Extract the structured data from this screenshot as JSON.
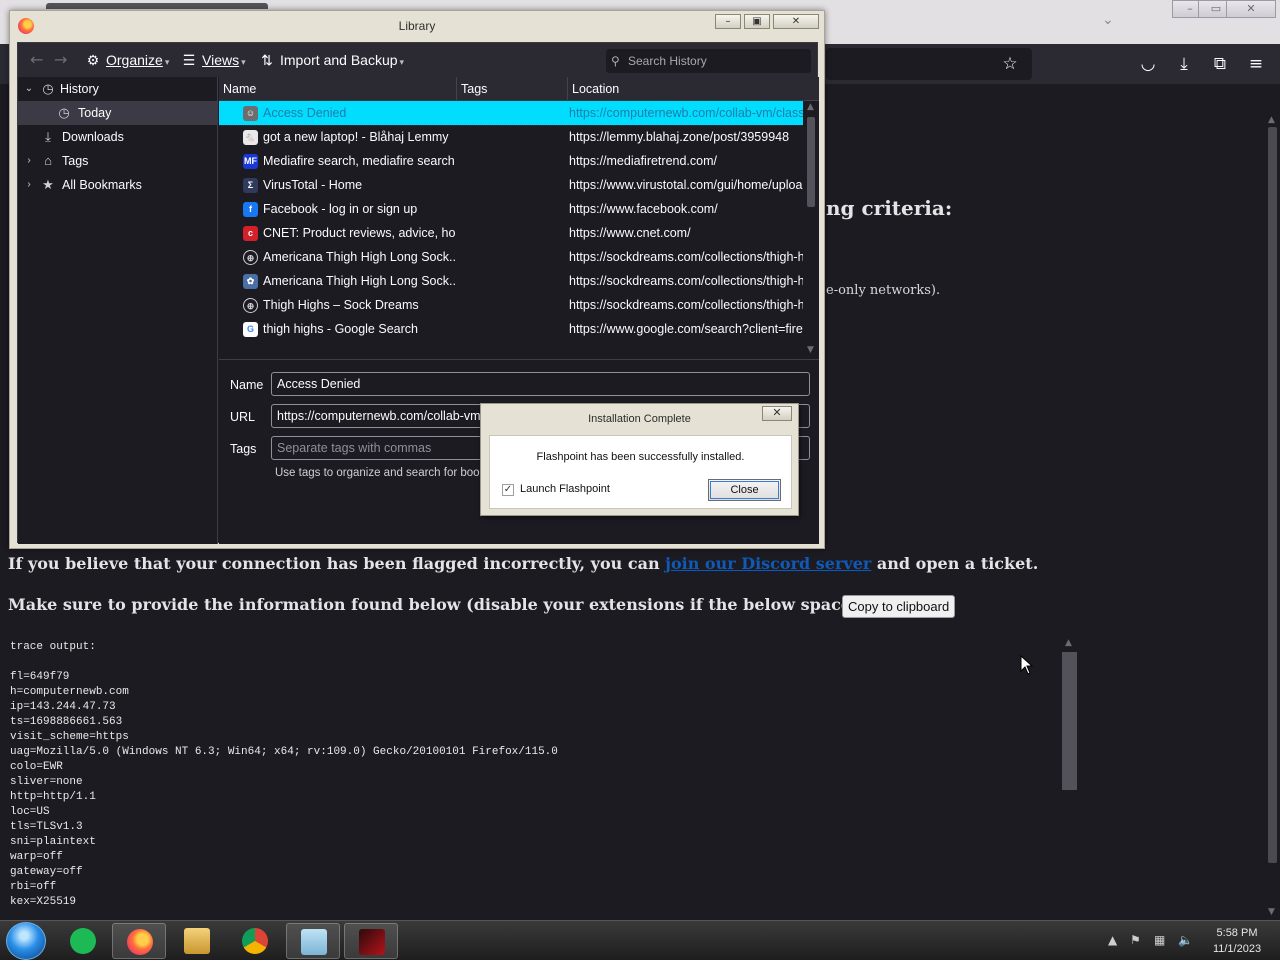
{
  "browser": {
    "page_fragments": {
      "criteria": "ng criteria:",
      "networks": "e-only networks)."
    },
    "flag_line": {
      "before": "If you believe that your connection has been flagged incorrectly, you can",
      "link": "join our Discord server",
      "after": "and open a ticket."
    },
    "provide_line": "Make sure to provide the information found below (disable your extensions if the below space is empty):",
    "copy_button": "Copy to clipboard",
    "trace_output": "trace output:\n\nfl=649f79\nh=computernewb.com\nip=143.244.47.73\nts=1698886661.563\nvisit_scheme=https\nuag=Mozilla/5.0 (Windows NT 6.3; Win64; x64; rv:109.0) Gecko/20100101 Firefox/115.0\ncolo=EWR\nsliver=none\nhttp=http/1.1\nloc=US\ntls=TLSv1.3\nsni=plaintext\nwarp=off\ngateway=off\nrbi=off\nkex=X25519"
  },
  "library": {
    "title": "Library",
    "toolbar": {
      "organize": "Organize",
      "views": "Views",
      "import_backup": "Import and Backup",
      "search_placeholder": "Search History"
    },
    "sidebar": [
      {
        "label": "History",
        "icon": "clock-icon",
        "expanded": true
      },
      {
        "label": "Today",
        "icon": "clock-icon",
        "selected": true
      },
      {
        "label": "Downloads",
        "icon": "download-icon"
      },
      {
        "label": "Tags",
        "icon": "tag-icon"
      },
      {
        "label": "All Bookmarks",
        "icon": "star-icon"
      }
    ],
    "columns": {
      "name": "Name",
      "tags": "Tags",
      "location": "Location"
    },
    "rows": [
      {
        "name": "Access Denied",
        "location": "https://computernewb.com/collab-vm/classic",
        "icon": "user-icon",
        "color": "#6d6d6d",
        "glyph": "☺"
      },
      {
        "name": "got a new laptop! - Blåhaj Lemmy",
        "location": "https://lemmy.blahaj.zone/post/3959948",
        "icon": "lemmy-icon",
        "color": "#e9e9e9",
        "glyph": "🐁"
      },
      {
        "name": "Mediafire search, mediafire search...",
        "location": "https://mediafiretrend.com/",
        "icon": "mediafire-icon",
        "color": "#1a38d8",
        "glyph": "MF"
      },
      {
        "name": "VirusTotal - Home",
        "location": "https://www.virustotal.com/gui/home/upload",
        "icon": "virustotal-icon",
        "color": "#2f3a5c",
        "glyph": "Σ"
      },
      {
        "name": "Facebook - log in or sign up",
        "location": "https://www.facebook.com/",
        "icon": "facebook-icon",
        "color": "#1877f2",
        "glyph": "f"
      },
      {
        "name": "CNET: Product reviews, advice, ho...",
        "location": "https://www.cnet.com/",
        "icon": "cnet-icon",
        "color": "#d3202a",
        "glyph": "c"
      },
      {
        "name": "Americana Thigh High Long Sock...",
        "location": "https://sockdreams.com/collections/thigh-highs",
        "icon": "globe-icon",
        "color": "#1c1b22",
        "glyph": "⊕"
      },
      {
        "name": "Americana Thigh High Long Sock...",
        "location": "https://sockdreams.com/collections/thigh-highs",
        "icon": "sockdreams-icon",
        "color": "#4a6fa5",
        "glyph": "✿"
      },
      {
        "name": "Thigh Highs – Sock Dreams",
        "location": "https://sockdreams.com/collections/thigh-highs",
        "icon": "globe-icon",
        "color": "#1c1b22",
        "glyph": "⊕"
      },
      {
        "name": "thigh highs - Google Search",
        "location": "https://www.google.com/search?client=firefox",
        "icon": "google-icon",
        "color": "#ffffff",
        "glyph": "G"
      }
    ],
    "details": {
      "name_label": "Name",
      "name_value": "Access Denied",
      "url_label": "URL",
      "url_value": "https://computernewb.com/collab-vm/classic/",
      "tags_label": "Tags",
      "tags_placeholder": "Separate tags with commas",
      "tags_help": "Use tags to organize and search for bookmarks."
    }
  },
  "dialog": {
    "title": "Installation Complete",
    "message": "Flashpoint has been successfully installed.",
    "checkbox_label": "Launch Flashpoint",
    "checkbox_checked": true,
    "close_button": "Close"
  },
  "taskbar": {
    "time": "5:58 PM",
    "date": "11/1/2023"
  }
}
